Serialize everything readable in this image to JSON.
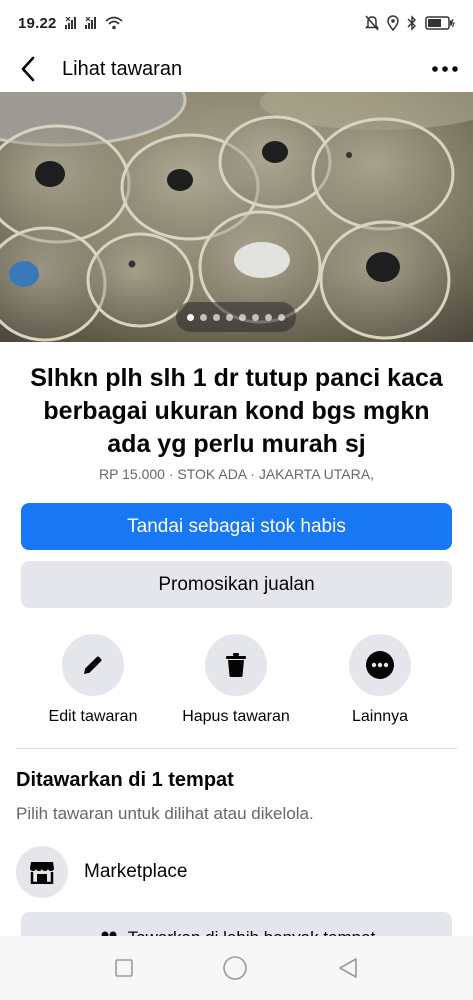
{
  "status_bar": {
    "time": "19.22",
    "icons": [
      "signal-x-icon",
      "signal-x-icon",
      "wifi-icon",
      "mute-icon",
      "location-icon",
      "bluetooth-icon",
      "battery-icon"
    ]
  },
  "header": {
    "title": "Lihat tawaran",
    "back_icon": "back-arrow-icon",
    "more_icon": "more-dots-icon"
  },
  "photo": {
    "image_count": 8,
    "active_index": 0
  },
  "listing": {
    "title": "Slhkn plh slh 1 dr tutup panci kaca berbagai ukuran kond bgs mgkn ada yg perlu murah sj",
    "meta": "RP 15.000 · STOK ADA · JAKARTA UTARA,"
  },
  "buttons": {
    "mark_sold": "Tandai sebagai stok habis",
    "promote": "Promosikan jualan"
  },
  "actions": [
    {
      "label": "Edit tawaran",
      "icon": "pencil-icon"
    },
    {
      "label": "Hapus tawaran",
      "icon": "trash-icon"
    },
    {
      "label": "Lainnya",
      "icon": "more-circle-icon"
    }
  ],
  "offered": {
    "title": "Ditawarkan di 1 tempat",
    "subtitle": "Pilih tawaran untuk dilihat atau dikelola.",
    "places": [
      {
        "label": "Marketplace",
        "icon": "marketplace-store-icon"
      }
    ],
    "more_button": "Tawarkan di lebih banyak tempat"
  },
  "colors": {
    "primary": "#1877f2",
    "secondary_bg": "#e4e6eb",
    "muted_text": "#65676b"
  }
}
